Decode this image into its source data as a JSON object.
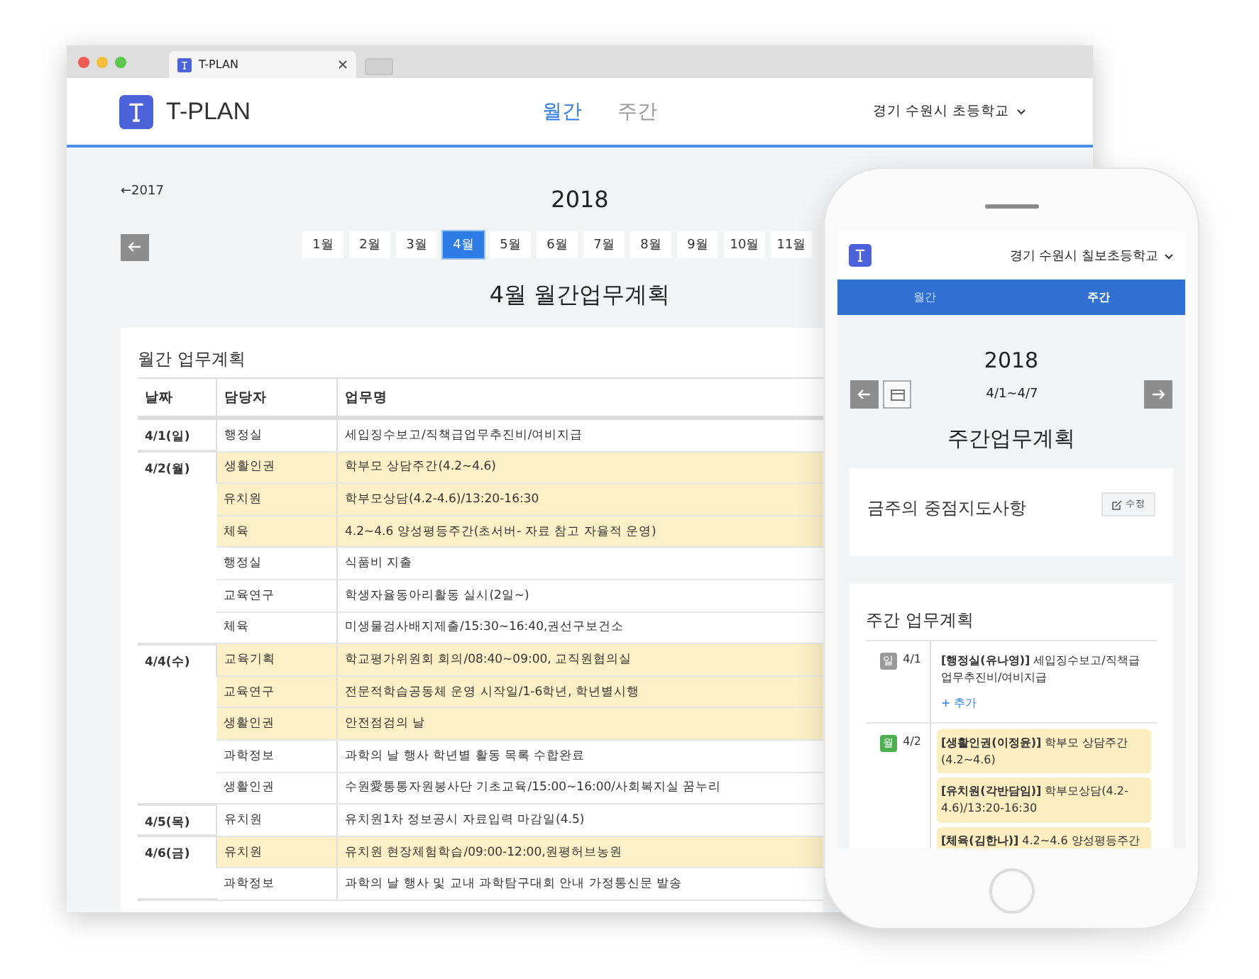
{
  "browser": {
    "tab_title": "T-PLAN"
  },
  "header": {
    "brand": "T-PLAN",
    "nav": [
      {
        "label": "월간",
        "selected": true
      },
      {
        "label": "주간",
        "selected": false
      }
    ],
    "school": "경기 수원시 초등학교"
  },
  "year_nav": {
    "previous": "←2017",
    "year": "2018"
  },
  "months": [
    {
      "label": "1월",
      "selected": false
    },
    {
      "label": "2월",
      "selected": false
    },
    {
      "label": "3월",
      "selected": false
    },
    {
      "label": "4월",
      "selected": true
    },
    {
      "label": "5월",
      "selected": false
    },
    {
      "label": "6월",
      "selected": false
    },
    {
      "label": "7월",
      "selected": false
    },
    {
      "label": "8월",
      "selected": false
    },
    {
      "label": "9월",
      "selected": false
    },
    {
      "label": "10월",
      "selected": false
    },
    {
      "label": "11월",
      "selected": false
    }
  ],
  "page_title": "4월 월간업무계획",
  "monthly_plan": {
    "title": "월간 업무계획",
    "columns": [
      "날짜",
      "담당자",
      "업무명"
    ],
    "groups": [
      {
        "date": "4/1(일)",
        "items": [
          {
            "dept": "행정실",
            "task": "세입징수보고/직책급업무추진비/여비지급",
            "highlighted": false
          }
        ]
      },
      {
        "date": "4/2(월)",
        "items": [
          {
            "dept": "생활인권",
            "task": "학부모 상담주간(4.2~4.6)",
            "highlighted": true
          },
          {
            "dept": "유치원",
            "task": "학부모상담(4.2-4.6)/13:20-16:30",
            "highlighted": true
          },
          {
            "dept": "체육",
            "task": "4.2~4.6 양성평등주간(초서버- 자료 참고 자율적 운영)",
            "highlighted": true
          },
          {
            "dept": "행정실",
            "task": "식품비 지출",
            "highlighted": false
          },
          {
            "dept": "교육연구",
            "task": "학생자율동아리활동 실시(2일~)",
            "highlighted": false
          },
          {
            "dept": "체육",
            "task": "미생물검사배지제출/15:30~16:40,권선구보건소",
            "highlighted": false
          }
        ]
      },
      {
        "date": "4/4(수)",
        "items": [
          {
            "dept": "교육기획",
            "task": "학교평가위원회 회의/08:40~09:00, 교직원협의실",
            "highlighted": true
          },
          {
            "dept": "교육연구",
            "task": "전문적학습공동체 운영 시작일/1-6학년, 학년별시행",
            "highlighted": true
          },
          {
            "dept": "생활인권",
            "task": "안전점검의 날",
            "highlighted": true
          },
          {
            "dept": "과학정보",
            "task": "과학의 날 행사 학년별 활동 목록 수합완료",
            "highlighted": false
          },
          {
            "dept": "생활인권",
            "task": "수원愛통통자원봉사단 기초교육/15:00~16:00/사회복지실 꿈누리",
            "highlighted": false
          }
        ]
      },
      {
        "date": "4/5(목)",
        "items": [
          {
            "dept": "유치원",
            "task": "유치원1차 정보공시 자료입력 마감일(4.5)",
            "highlighted": false
          }
        ]
      },
      {
        "date": "4/6(금)",
        "items": [
          {
            "dept": "유치원",
            "task": "유치원 현장체험학습/09:00-12:00,원평허브농원",
            "highlighted": true
          },
          {
            "dept": "과학정보",
            "task": "과학의 날 행사 및 교내 과학탐구대회 안내 가정통신문 발송",
            "highlighted": false
          }
        ]
      }
    ]
  },
  "mobile": {
    "school": "경기 수원시 칠보초등학교",
    "tabs": [
      {
        "label": "월간",
        "selected": false
      },
      {
        "label": "주간",
        "selected": true
      }
    ],
    "year": "2018",
    "week_range": "4/1~4/7",
    "title": "주간업무계획",
    "focus_card": {
      "title": "금주의 중점지도사항",
      "edit_button": "수정"
    },
    "weekly_plan": {
      "title": "주간 업무계획",
      "days": [
        {
          "weekday": "일",
          "color": "#9a9a9a",
          "date": "4/1",
          "add_link": "+ 추가",
          "entries": [
            {
              "text": "**[행정실(유나영)]** 세입징수보고/직책급업무추진비/여비지급",
              "highlighted": false
            }
          ]
        },
        {
          "weekday": "월",
          "color": "#4cb050",
          "date": "4/2",
          "entries": [
            {
              "text": "**[생활인권(이정윤)]** 학부모 상담주간(4.2~4.6)",
              "highlighted": true
            },
            {
              "text": "**[유치원(각반담임)]** 학부모상담(4.2-4.6)/13:20-16:30",
              "highlighted": true
            },
            {
              "text": "**[체육(김한나)]** 4.2~4.6 양성평등주간",
              "highlighted": true
            }
          ]
        }
      ]
    }
  }
}
